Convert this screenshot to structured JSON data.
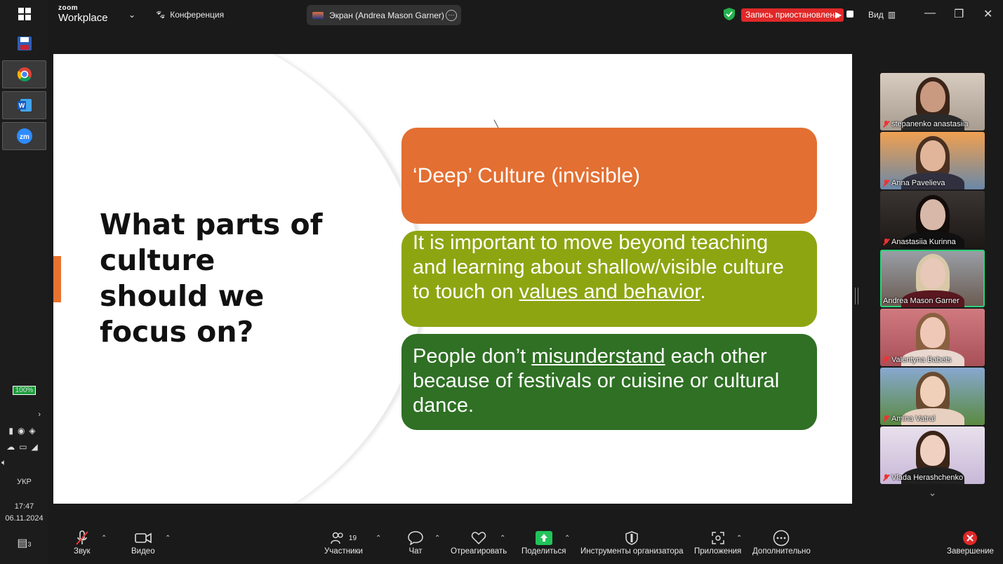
{
  "window": {
    "app_name_top": "zoom",
    "app_name": "Workplace",
    "meeting_label": "Конференция",
    "screen_share_label": "Экран (Andrea Mason Garner)",
    "recording_status": "Запись приостановлена",
    "view_label": "Вид"
  },
  "taskbar": {
    "battery": "100%",
    "language": "УКР",
    "time": "17:47",
    "date": "06.11.2024",
    "notifications": "3"
  },
  "slide": {
    "title": "What parts of\nculture\nshould we\nfocus on?",
    "box1": "‘Deep’ Culture (invisible)",
    "box2_a": "It is important to move beyond teaching and learning about shallow/visible culture to touch on ",
    "box2_u": "values and behavior",
    "box2_b": ".",
    "box3_a": "People don’t ",
    "box3_u": "misunderstand",
    "box3_b": " each other because of festivals or cuisine or cultural dance.",
    "colors": {
      "box1": "#e36f32",
      "box2": "#8ea512",
      "box3": "#2f7024",
      "accent": "#e8722f"
    }
  },
  "participants": [
    {
      "name": "stepanenko anastasiia",
      "muted": true
    },
    {
      "name": "Anna Pavelieva",
      "muted": true
    },
    {
      "name": "Anastasiia Kurinna",
      "muted": true
    },
    {
      "name": "Andrea Mason Garner",
      "muted": false,
      "speaking": true
    },
    {
      "name": "Valentyna Babets",
      "muted": true
    },
    {
      "name": "Amina Vatral",
      "muted": true
    },
    {
      "name": "Vlada Herashchenko",
      "muted": true
    }
  ],
  "toolbar": {
    "audio": "Звук",
    "video": "Видео",
    "participants": "Участники",
    "participants_count": "19",
    "chat": "Чат",
    "react": "Отреагировать",
    "share": "Поделиться",
    "host_tools": "Инструменты организатора",
    "apps": "Приложения",
    "more": "Дополнительно",
    "end": "Завершение"
  }
}
